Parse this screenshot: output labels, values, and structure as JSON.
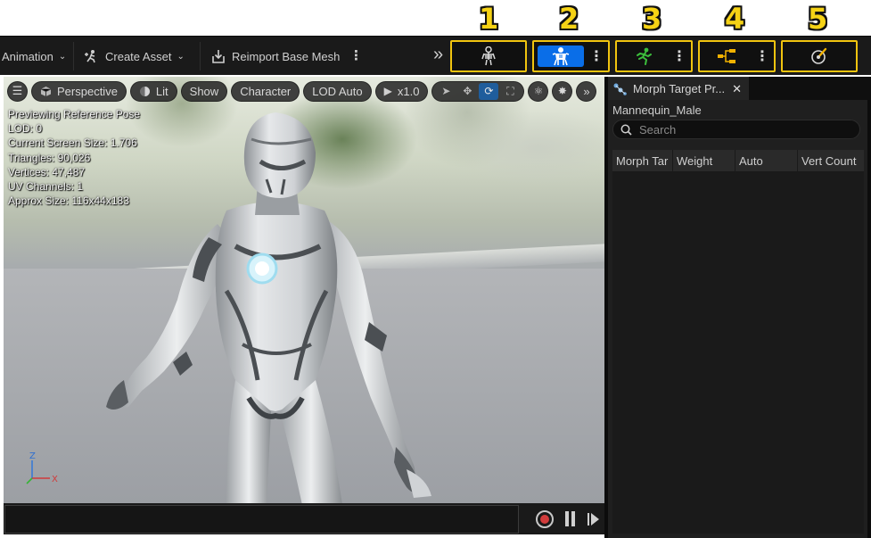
{
  "annotations": [
    "1",
    "2",
    "3",
    "4",
    "5"
  ],
  "toolbar": {
    "animation_label": "Animation",
    "create_asset_label": "Create Asset",
    "reimport_label": "Reimport Base Mesh",
    "overflow_glyph": "»"
  },
  "modes": [
    {
      "icon": "skeleton-icon",
      "active": false,
      "has_menu": false
    },
    {
      "icon": "skeletal-mesh-icon",
      "active": true,
      "has_menu": true,
      "accent": "#0a6ee8"
    },
    {
      "icon": "running-figure-icon",
      "active": false,
      "has_menu": true,
      "accent": "#3cbe3c"
    },
    {
      "icon": "blueprint-graph-icon",
      "active": false,
      "has_menu": true,
      "accent": "#f2b200"
    },
    {
      "icon": "physics-icon",
      "active": false,
      "has_menu": false
    }
  ],
  "viewport": {
    "perspective_label": "Perspective",
    "lit_label": "Lit",
    "show_label": "Show",
    "character_label": "Character",
    "lod_label": "LOD Auto",
    "speed_label": "x1.0",
    "stats": [
      "Previewing Reference Pose",
      "LOD: 0",
      "Current Screen Size: 1.706",
      "Triangles: 90,026",
      "Vertices: 47,487",
      "UV Channels: 1",
      "Approx Size: 116x44x183"
    ],
    "axis_labels": {
      "z": "Z",
      "x": "X"
    }
  },
  "panel": {
    "tab_title": "Morph Target Pr...",
    "mesh_name": "Mannequin_Male",
    "search_placeholder": "Search",
    "columns": [
      "Morph Tar",
      "Weight",
      "Auto",
      "Vert Count"
    ]
  }
}
